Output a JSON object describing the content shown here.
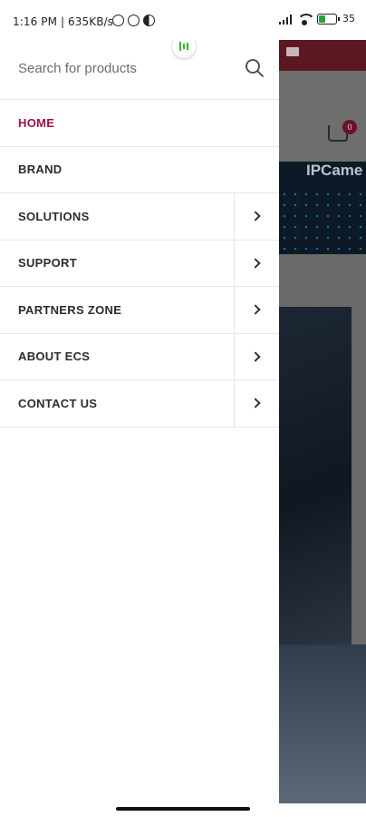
{
  "status_bar": {
    "time_speed": "1:16 PM | 635KB/s",
    "battery_percent": "35"
  },
  "drawer": {
    "search": {
      "placeholder": "Search for products"
    },
    "menu_items": [
      {
        "label": "HOME",
        "active": true,
        "has_submenu": false
      },
      {
        "label": "BRAND",
        "active": false,
        "has_submenu": false
      },
      {
        "label": "SOLUTIONS",
        "active": false,
        "has_submenu": true
      },
      {
        "label": "SUPPORT",
        "active": false,
        "has_submenu": true
      },
      {
        "label": "PARTNERS ZONE",
        "active": false,
        "has_submenu": true
      },
      {
        "label": "ABOUT ECS",
        "active": false,
        "has_submenu": true
      },
      {
        "label": "CONTACT US",
        "active": false,
        "has_submenu": true
      }
    ]
  },
  "background_page": {
    "cart_count": "0",
    "banner_text": "IPCame"
  },
  "colors": {
    "accent": "#9a1349",
    "brand_bar": "#5b1822",
    "mic_green": "#2eb82e"
  },
  "icons": [
    "search-icon",
    "chevron-right-icon",
    "cart-icon",
    "mail-icon",
    "mic-icon"
  ]
}
